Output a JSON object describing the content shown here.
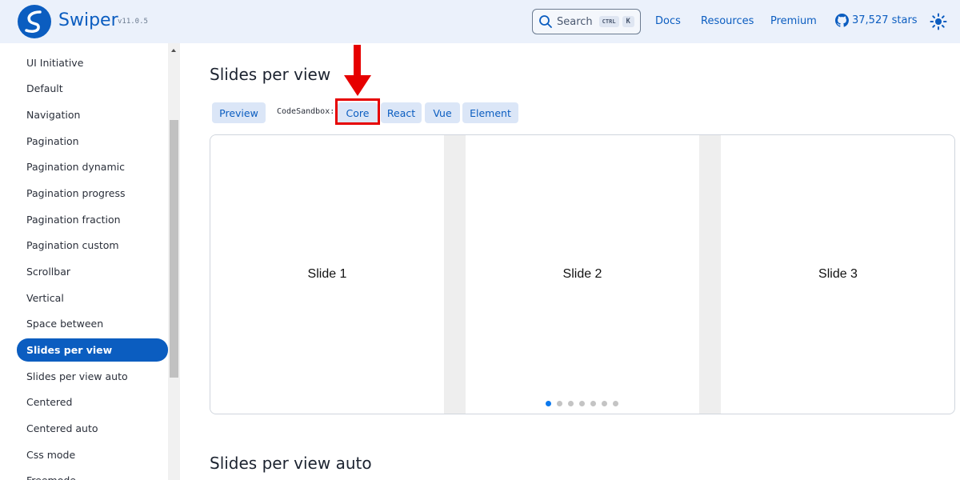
{
  "header": {
    "brand": "Swiper",
    "version": "v11.0.5",
    "search_label": "Search",
    "search_kbd_ctrl": "CTRL",
    "search_kbd_key": "K",
    "nav": [
      "Docs",
      "Resources",
      "Premium"
    ],
    "stars": "37,527 stars",
    "brand_color": "#0b5dc0"
  },
  "sidebar": {
    "items": [
      {
        "label": "UI Initiative"
      },
      {
        "label": "Default"
      },
      {
        "label": "Navigation"
      },
      {
        "label": "Pagination"
      },
      {
        "label": "Pagination dynamic"
      },
      {
        "label": "Pagination progress"
      },
      {
        "label": "Pagination fraction"
      },
      {
        "label": "Pagination custom"
      },
      {
        "label": "Scrollbar"
      },
      {
        "label": "Vertical"
      },
      {
        "label": "Space between"
      },
      {
        "label": "Slides per view",
        "active": true
      },
      {
        "label": "Slides per view auto"
      },
      {
        "label": "Centered"
      },
      {
        "label": "Centered auto"
      },
      {
        "label": "Css mode"
      },
      {
        "label": "Freemode"
      }
    ]
  },
  "main": {
    "section1_title": "Slides per view",
    "preview_button": "Preview",
    "codesandbox_label": "CodeSandbox:",
    "sandbox_buttons": [
      "Core",
      "React",
      "Vue",
      "Element"
    ],
    "highlighted_button": "Core",
    "slides": [
      "Slide 1",
      "Slide 2",
      "Slide 3"
    ],
    "pagination_total": 7,
    "pagination_active": 1,
    "section2_title": "Slides per view auto"
  },
  "annotation": {
    "color": "#e60000",
    "icon": "red-arrow-down"
  }
}
